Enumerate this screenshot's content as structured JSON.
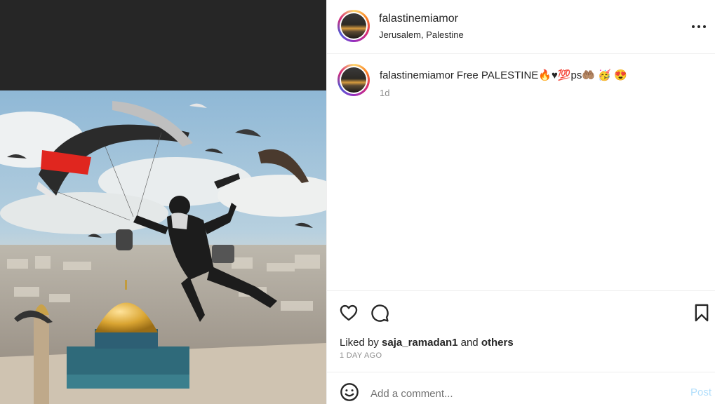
{
  "post": {
    "username": "falastinemiamor",
    "location": "Jerusalem, Palestine",
    "caption_user": "falastinemiamor",
    "caption_text": "Free PALESTINE🔥♥💯ps🤲🏽 🥳 😍",
    "time": "1d",
    "liked_prefix": "Liked by",
    "liked_user": "saja_ramadan1",
    "liked_and": "and",
    "liked_others": "others",
    "ago": "1 DAY AGO"
  },
  "comment": {
    "placeholder": "Add a comment...",
    "post_label": "Post"
  },
  "icons": {
    "more": "more-options-icon",
    "like": "heart-icon",
    "comment": "comment-icon",
    "save": "bookmark-icon",
    "emoji": "emoji-icon"
  },
  "colors": {
    "text": "#262626",
    "muted": "#8e8e8e",
    "post_button": "#b2dffc",
    "divider": "#efefef",
    "media_backdrop": "#262626"
  }
}
